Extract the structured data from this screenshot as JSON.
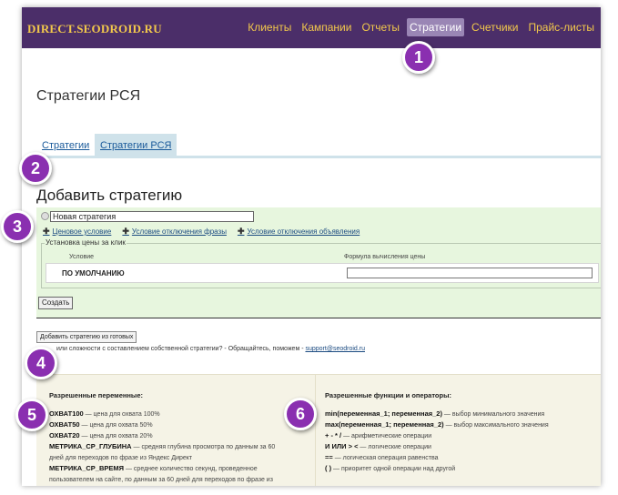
{
  "header": {
    "logo": "DIRECT.SEODROID.RU",
    "nav": [
      {
        "label": "Клиенты",
        "active": false
      },
      {
        "label": "Кампании",
        "active": false
      },
      {
        "label": "Отчеты",
        "active": false
      },
      {
        "label": "Стратегии",
        "active": true
      },
      {
        "label": "Счетчики",
        "active": false
      },
      {
        "label": "Прайс-листы",
        "active": false
      }
    ]
  },
  "page": {
    "title": "Стратегии РСЯ",
    "tabs": [
      {
        "label": "Стратегии"
      },
      {
        "label": "Стратегии РСЯ"
      }
    ]
  },
  "form": {
    "title": "Добавить стратегию",
    "name_value": "Новая стратегия",
    "condition_links": [
      "Ценовое условие",
      "Условие отключения фразы",
      "Условие отключения объявления"
    ],
    "fieldset_legend": "Установка цены за клик",
    "col_condition": "Условие",
    "col_formula": "Формула вычисления цены",
    "default_label": "ПО УМОЛЧАНИЮ",
    "create_label": "Создать"
  },
  "ready": {
    "button_label": "Добавить стратегию из готовых",
    "help_text": "или сложности с составлением собственной стратегии? - Обращайтесь, поможем - ",
    "help_email": "support@seodroid.ru"
  },
  "variables": {
    "heading": "Разрешенные переменные:",
    "items": [
      {
        "name": "ОХВАТ100",
        "desc": " — цена для охвата 100%"
      },
      {
        "name": "ОХВАТ50",
        "desc": " — цена для охвата 50%"
      },
      {
        "name": "ОХВАТ20",
        "desc": " — цена для охвата 20%"
      },
      {
        "name": "МЕТРИКА_СР_ГЛУБИНА",
        "desc": " — средняя глубина просмотра по данным за 60"
      },
      {
        "name": "",
        "desc": "дней для переходов по фразе из Яндекс Директ"
      },
      {
        "name": "МЕТРИКА_СР_ВРЕМЯ",
        "desc": " — среднее количество секунд, проведенное"
      },
      {
        "name": "",
        "desc": "пользователем на сайте, по данным за 60 дней для переходов по фразе из"
      }
    ]
  },
  "functions": {
    "heading": "Разрешенные функции и операторы:",
    "items": [
      {
        "name": "min(переменная_1; переменная_2)",
        "desc": " — выбор минимального значения"
      },
      {
        "name": "max(переменная_1; переменная_2)",
        "desc": " — выбор максимального значения"
      },
      {
        "name": "+ - * /",
        "desc": " — арифметические операции"
      },
      {
        "name": "И ИЛИ > <",
        "desc": " — логические операции"
      },
      {
        "name": "==",
        "desc": " — логическая операция равенства"
      },
      {
        "name": "( )",
        "desc": " — приоритет одной операции над другой"
      }
    ]
  },
  "badges": [
    "1",
    "2",
    "3",
    "4",
    "5",
    "6"
  ],
  "colors": {
    "header_bg": "#4b2e69",
    "nav_text": "#f2c84b",
    "badge": "#8a2fb0",
    "form_bg": "#e7f6de"
  }
}
